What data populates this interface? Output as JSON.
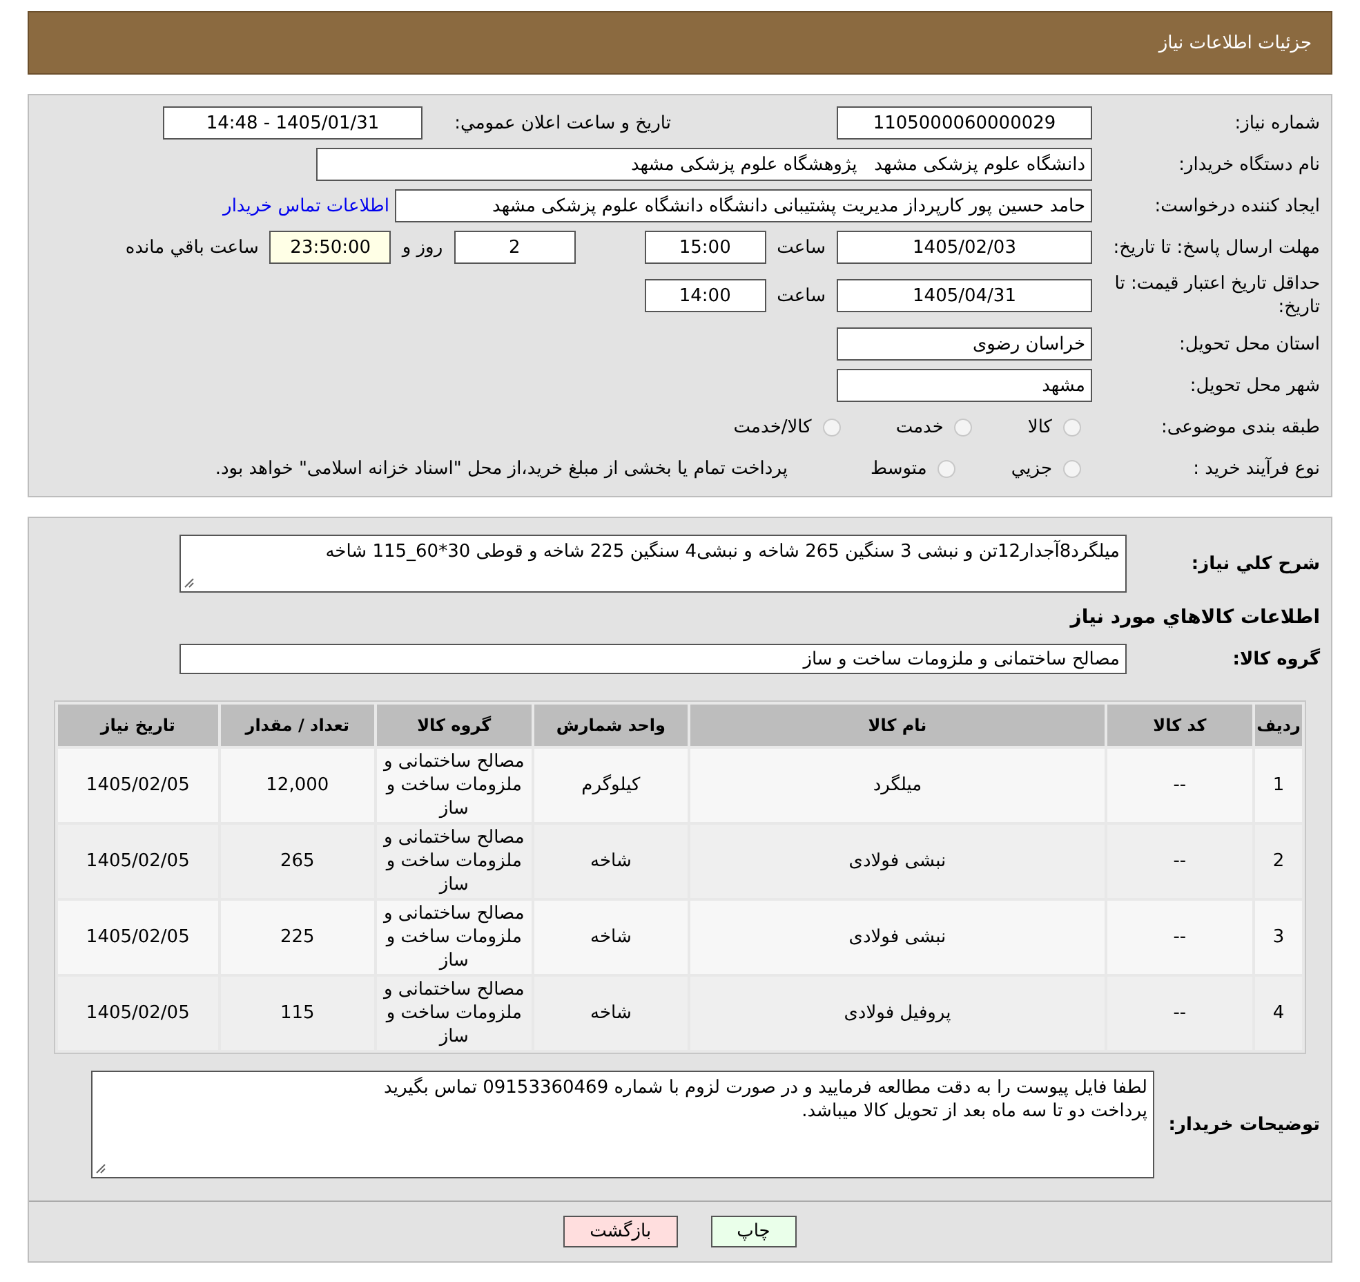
{
  "header": {
    "title": "جزئیات اطلاعات نیاز"
  },
  "details": {
    "need_number": {
      "label": "شماره نیاز:",
      "value": "1105000060000029"
    },
    "announce": {
      "label": "تاریخ و ساعت اعلان عمومي:",
      "value": "1405/01/31 - 14:48"
    },
    "buyer": {
      "label": "نام دستگاه خریدار:",
      "value": "دانشگاه علوم پزشکی مشهد   پژوهشگاه علوم پزشکی مشهد"
    },
    "creator": {
      "label": "ایجاد کننده درخواست:",
      "value": "حامد حسین پور کارپرداز مدیریت پشتیبانی دانشگاه دانشگاه علوم پزشکی مشهد",
      "link": "اطلاعات تماس خریدار"
    },
    "deadline": {
      "label": "مهلت ارسال پاسخ: تا تاریخ:",
      "date": "1405/02/03",
      "time_label": "ساعت",
      "time": "15:00",
      "days": "2",
      "days_label": "روز و",
      "remaining": "23:50:00",
      "remaining_label": "ساعت باقي مانده"
    },
    "validity": {
      "label": "حداقل تاریخ اعتبار قیمت: تا تاریخ:",
      "date": "1405/04/31",
      "time_label": "ساعت",
      "time": "14:00"
    },
    "province": {
      "label": "استان محل تحویل:",
      "value": "خراسان رضوی"
    },
    "city": {
      "label": "شهر محل تحویل:",
      "value": "مشهد"
    },
    "category": {
      "label": "طبقه بندی موضوعی:",
      "options": [
        {
          "label": "کالا",
          "selected": false
        },
        {
          "label": "خدمت",
          "selected": false
        },
        {
          "label": "کالا/خدمت",
          "selected": false
        }
      ]
    },
    "purchase_type": {
      "label": "نوع فرآیند خرید :",
      "options": [
        {
          "label": "جزيي",
          "selected": false
        },
        {
          "label": "متوسط",
          "selected": false
        }
      ],
      "note": "پرداخت تمام یا بخشی از مبلغ خرید،از محل \"اسناد خزانه اسلامی\" خواهد بود."
    }
  },
  "summary": {
    "label": "شرح کلي نياز:",
    "value": "میلگرد8آجدار12تن و نبشی 3 سنگین 265 شاخه و نبشی4 سنگین 225 شاخه و قوطی 30*60_115 شاخه"
  },
  "items_heading": "اطلاعات کالاهاي مورد نياز",
  "goods_group": {
    "label": "گروه کالا:",
    "value": "مصالح ساختمانی و ملزومات ساخت و ساز"
  },
  "table": {
    "columns": [
      "ردیف",
      "کد کالا",
      "نام کالا",
      "واحد شمارش",
      "گروه کالا",
      "تعداد / مقدار",
      "تاریخ نیاز"
    ],
    "rows": [
      [
        "1",
        "--",
        "میلگرد",
        "کیلوگرم",
        "مصالح ساختمانی و ملزومات ساخت و ساز",
        "12,000",
        "1405/02/05"
      ],
      [
        "2",
        "--",
        "نبشی فولادی",
        "شاخه",
        "مصالح ساختمانی و ملزومات ساخت و ساز",
        "265",
        "1405/02/05"
      ],
      [
        "3",
        "--",
        "نبشی فولادی",
        "شاخه",
        "مصالح ساختمانی و ملزومات ساخت و ساز",
        "225",
        "1405/02/05"
      ],
      [
        "4",
        "--",
        "پروفیل فولادی",
        "شاخه",
        "مصالح ساختمانی و ملزومات ساخت و ساز",
        "115",
        "1405/02/05"
      ]
    ]
  },
  "buyer_notes": {
    "label": "توضیحات خریدار:",
    "lines": [
      "لطفا فایل پیوست را به دقت مطالعه فرمایید و در صورت لزوم با شماره 09153360469 تماس بگیرید",
      "پرداخت دو تا سه ماه بعد از تحویل کالا میباشد."
    ]
  },
  "buttons": [
    {
      "kind": "print",
      "label": "چاپ"
    },
    {
      "kind": "back",
      "label": "بازگشت"
    }
  ]
}
